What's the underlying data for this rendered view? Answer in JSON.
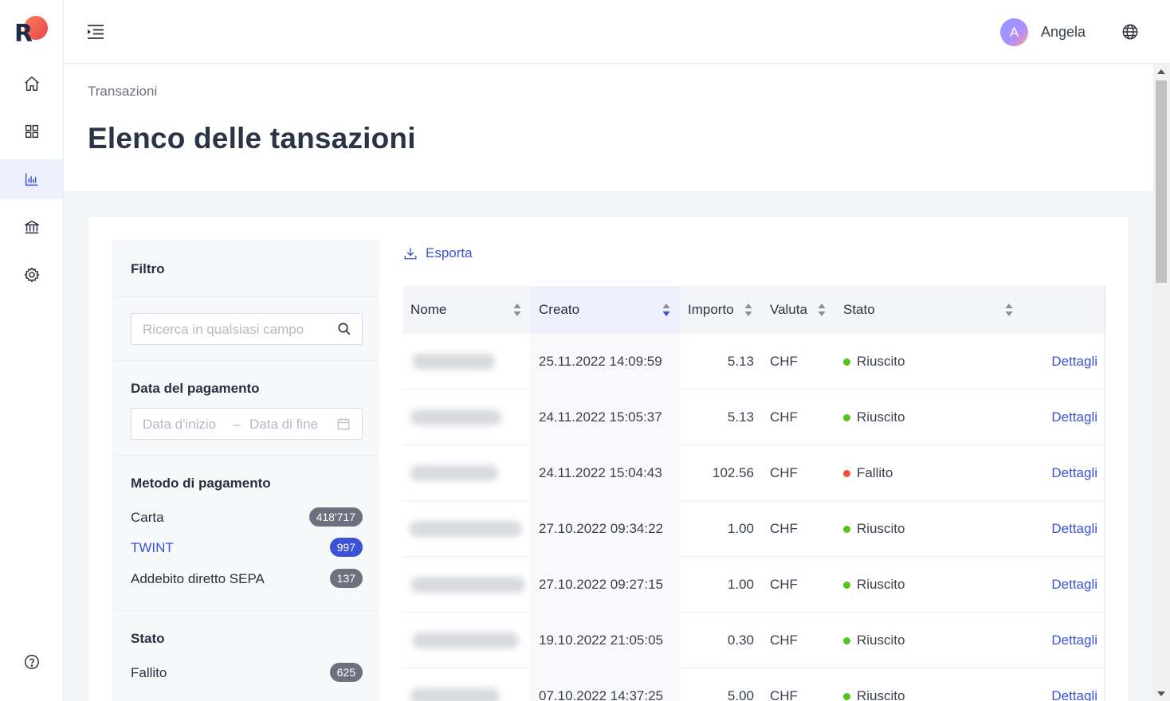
{
  "app": {
    "logo_letter": "R"
  },
  "user": {
    "initial": "A",
    "name": "Angela"
  },
  "sidebar": {
    "items": [
      {
        "icon": "home-icon"
      },
      {
        "icon": "grid-icon"
      },
      {
        "icon": "chart-icon",
        "active": true
      },
      {
        "icon": "bank-icon"
      },
      {
        "icon": "settings-icon"
      },
      {
        "icon": "help-icon"
      }
    ]
  },
  "header": {
    "breadcrumb": "Transazioni",
    "title": "Elenco delle tansazioni"
  },
  "filter": {
    "title": "Filtro",
    "search_placeholder": "Ricerca in qualsiasi campo",
    "date": {
      "title": "Data del pagamento",
      "start_placeholder": "Data d'inizio",
      "separator": "–",
      "end_placeholder": "Data di fine"
    },
    "method": {
      "title": "Metodo di pagamento",
      "items": [
        {
          "label": "Carta",
          "count": "418'717"
        },
        {
          "label": "TWINT",
          "count": "997",
          "selected": true
        },
        {
          "label": "Addebito diretto SEPA",
          "count": "137"
        }
      ]
    },
    "status": {
      "title": "Stato",
      "items": [
        {
          "label": "Fallito",
          "count": "625"
        }
      ]
    }
  },
  "toolbar": {
    "export_label": "Esporta"
  },
  "table": {
    "columns": {
      "name": "Nome",
      "created": "Creato",
      "amount": "Importo",
      "currency": "Valuta",
      "status": "Stato"
    },
    "rows": [
      {
        "created": "25.11.2022 14:09:59",
        "amount": "5.13",
        "currency": "CHF",
        "status": "Riuscito",
        "ok": true,
        "details": "Dettagli"
      },
      {
        "created": "24.11.2022 15:05:37",
        "amount": "5.13",
        "currency": "CHF",
        "status": "Riuscito",
        "ok": true,
        "details": "Dettagli"
      },
      {
        "created": "24.11.2022 15:04:43",
        "amount": "102.56",
        "currency": "CHF",
        "status": "Fallito",
        "ok": false,
        "details": "Dettagli"
      },
      {
        "created": "27.10.2022 09:34:22",
        "amount": "1.00",
        "currency": "CHF",
        "status": "Riuscito",
        "ok": true,
        "details": "Dettagli"
      },
      {
        "created": "27.10.2022 09:27:15",
        "amount": "1.00",
        "currency": "CHF",
        "status": "Riuscito",
        "ok": true,
        "details": "Dettagli"
      },
      {
        "created": "19.10.2022 21:05:05",
        "amount": "0.30",
        "currency": "CHF",
        "status": "Riuscito",
        "ok": true,
        "details": "Dettagli"
      },
      {
        "created": "07.10.2022 14:37:25",
        "amount": "5.00",
        "currency": "CHF",
        "status": "Riuscito",
        "ok": true,
        "details": "Dettagli"
      }
    ]
  },
  "colors": {
    "accent": "#3b52d6",
    "success": "#52c41a",
    "error": "#f5503f",
    "badge": "#6c717d"
  }
}
